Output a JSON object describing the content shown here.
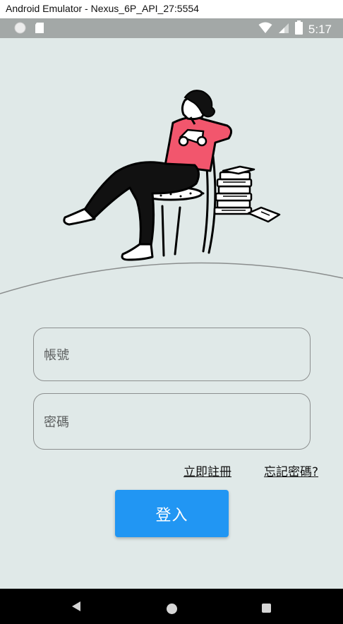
{
  "window": {
    "title": "Android Emulator - Nexus_6P_API_27:5554"
  },
  "statusbar": {
    "time": "5:17",
    "icons": [
      "circle-notification-icon",
      "sd-card-icon",
      "wifi-icon",
      "signal-icon",
      "battery-icon"
    ]
  },
  "login": {
    "account_placeholder": "帳號",
    "password_placeholder": "密碼",
    "register_link": "立即註冊",
    "forgot_link": "忘記密碼?",
    "login_button": "登入"
  },
  "colors": {
    "background": "#e0e9e8",
    "accent": "#2196f3",
    "shirt": "#f2566d"
  },
  "navbar": {
    "icons": [
      "back-icon",
      "home-icon",
      "recents-icon"
    ]
  }
}
